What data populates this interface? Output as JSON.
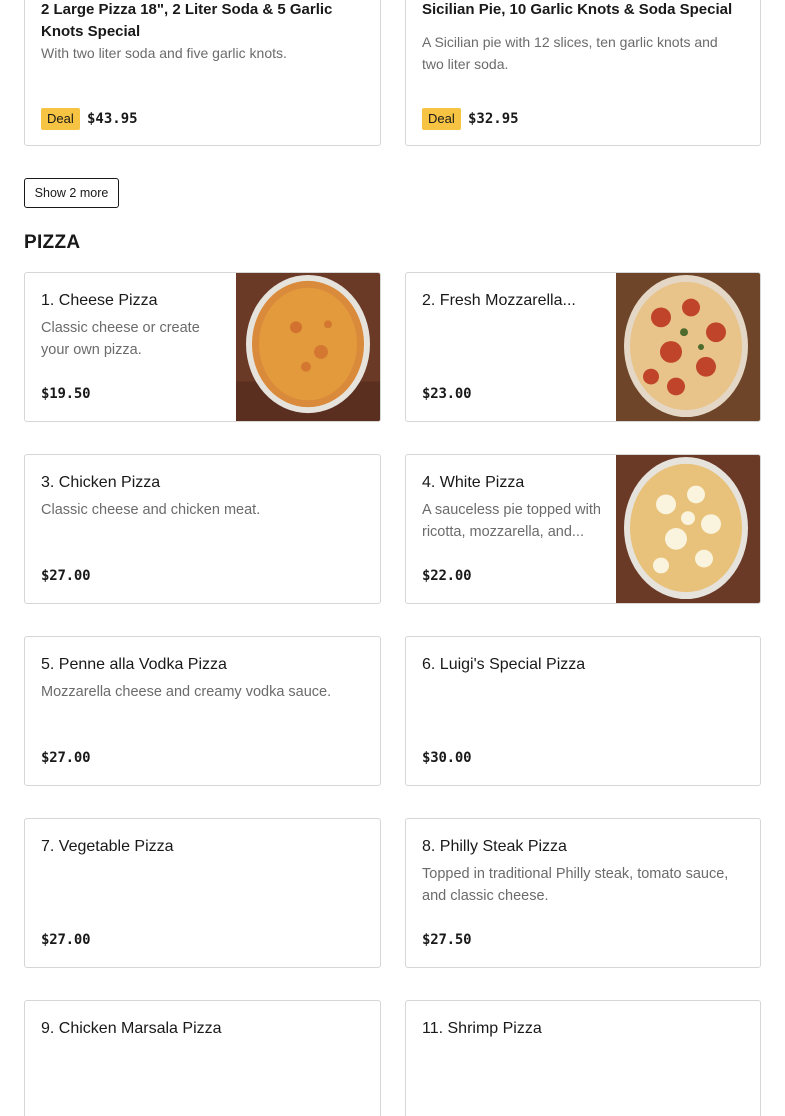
{
  "deals": [
    {
      "title": "2 Large Pizza 18\", 2 Liter Soda & 5 Garlic Knots Special",
      "description": "With two liter soda and five garlic knots.",
      "badge": "Deal",
      "price": "$43.95"
    },
    {
      "title": "Sicilian Pie, 10 Garlic Knots & Soda Special",
      "description": "A Sicilian pie with 12 slices, ten garlic knots and two liter soda.",
      "badge": "Deal",
      "price": "$32.95"
    }
  ],
  "show_more_label": "Show 2 more",
  "pizza_section": {
    "title": "PIZZA",
    "items": [
      {
        "name": "1. Cheese Pizza",
        "description": "Classic cheese or create your own pizza.",
        "price": "$19.50",
        "image": "cheese-pizza-photo"
      },
      {
        "name": "2. Fresh Mozzarella...",
        "description": "",
        "price": "$23.00",
        "image": "mozzarella-pizza-photo"
      },
      {
        "name": "3. Chicken Pizza",
        "description": "Classic cheese and chicken meat.",
        "price": "$27.00"
      },
      {
        "name": "4. White Pizza",
        "description": "A sauceless pie topped with ricotta, mozzarella, and...",
        "price": "$22.00",
        "image": "white-pizza-photo"
      },
      {
        "name": "5. Penne alla Vodka Pizza",
        "description": "Mozzarella cheese and creamy vodka sauce.",
        "price": "$27.00"
      },
      {
        "name": "6. Luigi's Special Pizza",
        "description": "",
        "price": "$30.00"
      },
      {
        "name": "7. Vegetable Pizza",
        "description": "",
        "price": "$27.00"
      },
      {
        "name": "8. Philly Steak Pizza",
        "description": "Topped in traditional Philly steak, tomato sauce, and classic cheese.",
        "price": "$27.50"
      },
      {
        "name": "9. Chicken Marsala Pizza",
        "description": "",
        "price": ""
      },
      {
        "name": "11. Shrimp Pizza",
        "description": "",
        "price": ""
      }
    ]
  },
  "colors": {
    "deal_badge": "#f6c342",
    "border": "#d6d6d6",
    "text": "#191919",
    "muted_text": "#6b6b6b"
  }
}
